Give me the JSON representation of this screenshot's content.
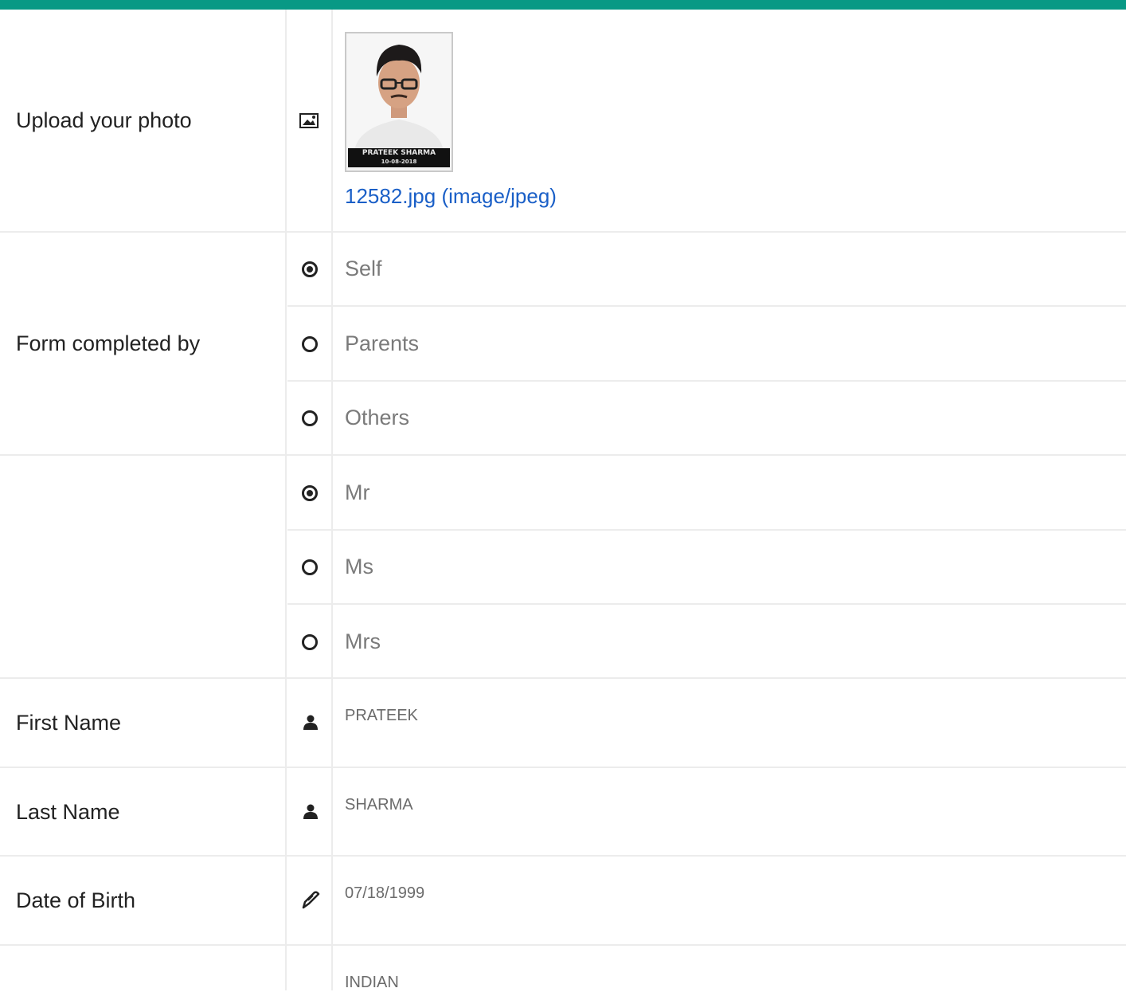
{
  "colors": {
    "accent": "#089985",
    "link": "#1a5fc7"
  },
  "photo_row": {
    "label": "Upload your photo",
    "icon": "image-icon",
    "photo_caption_name": "PRATEEK SHARMA",
    "photo_caption_date": "10-08-2018",
    "file_link": "12582.jpg (image/jpeg)"
  },
  "form_completed_by": {
    "label": "Form completed by",
    "selected": "Self",
    "options": [
      {
        "label": "Self",
        "checked": true
      },
      {
        "label": "Parents",
        "checked": false
      },
      {
        "label": "Others",
        "checked": false
      }
    ]
  },
  "salutation": {
    "label": "",
    "selected": "Mr",
    "options": [
      {
        "label": "Mr",
        "checked": true
      },
      {
        "label": "Ms",
        "checked": false
      },
      {
        "label": "Mrs",
        "checked": false
      }
    ]
  },
  "first_name": {
    "label": "First Name",
    "icon": "user-icon",
    "value": "PRATEEK"
  },
  "last_name": {
    "label": "Last Name",
    "icon": "user-icon",
    "value": "SHARMA"
  },
  "date_of_birth": {
    "label": "Date of Birth",
    "icon": "pencil-icon",
    "value": "07/18/1999"
  },
  "nationality": {
    "value": "INDIAN"
  }
}
